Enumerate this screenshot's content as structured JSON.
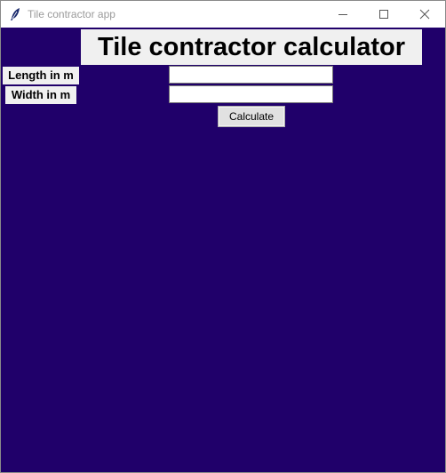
{
  "window": {
    "title": "Tile contractor app",
    "icon": "feather-icon",
    "controls": [
      "minimize-icon",
      "maximize-icon",
      "close-icon"
    ]
  },
  "app": {
    "heading": "Tile contractor calculator",
    "length_label": "Length in m",
    "width_label": "Width in m",
    "length_value": "",
    "width_value": "",
    "calculate_label": "Calculate"
  },
  "colors": {
    "background": "#20006a",
    "label_background": "#f0f0f0",
    "button_face": "#e1e1e1"
  }
}
